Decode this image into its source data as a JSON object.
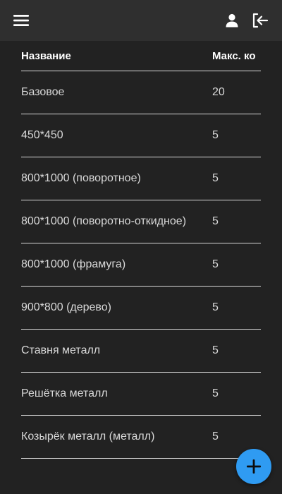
{
  "header": {
    "icons": {
      "menu": "hamburger-menu-icon",
      "user": "user-icon",
      "logout": "logout-icon"
    }
  },
  "table": {
    "columns": [
      "Название",
      "Макс. ко"
    ],
    "rows": [
      {
        "name": "Базовое",
        "max": "20"
      },
      {
        "name": "450*450",
        "max": "5"
      },
      {
        "name": "800*1000 (поворотное)",
        "max": "5"
      },
      {
        "name": "800*1000 (поворотно-откидное)",
        "max": "5"
      },
      {
        "name": "800*1000 (фрамуга)",
        "max": "5"
      },
      {
        "name": "900*800 (дерево)",
        "max": "5"
      },
      {
        "name": "Ставня металл",
        "max": "5"
      },
      {
        "name": "Решётка металл",
        "max": "5"
      },
      {
        "name": "Козырёк металл (металл)",
        "max": "5"
      }
    ]
  },
  "fab": {
    "icon": "plus-icon"
  },
  "colors": {
    "background": "#222222",
    "topbar": "#2f2f2f",
    "accent": "#2f9bf2",
    "divider": "#d8d8d8"
  }
}
